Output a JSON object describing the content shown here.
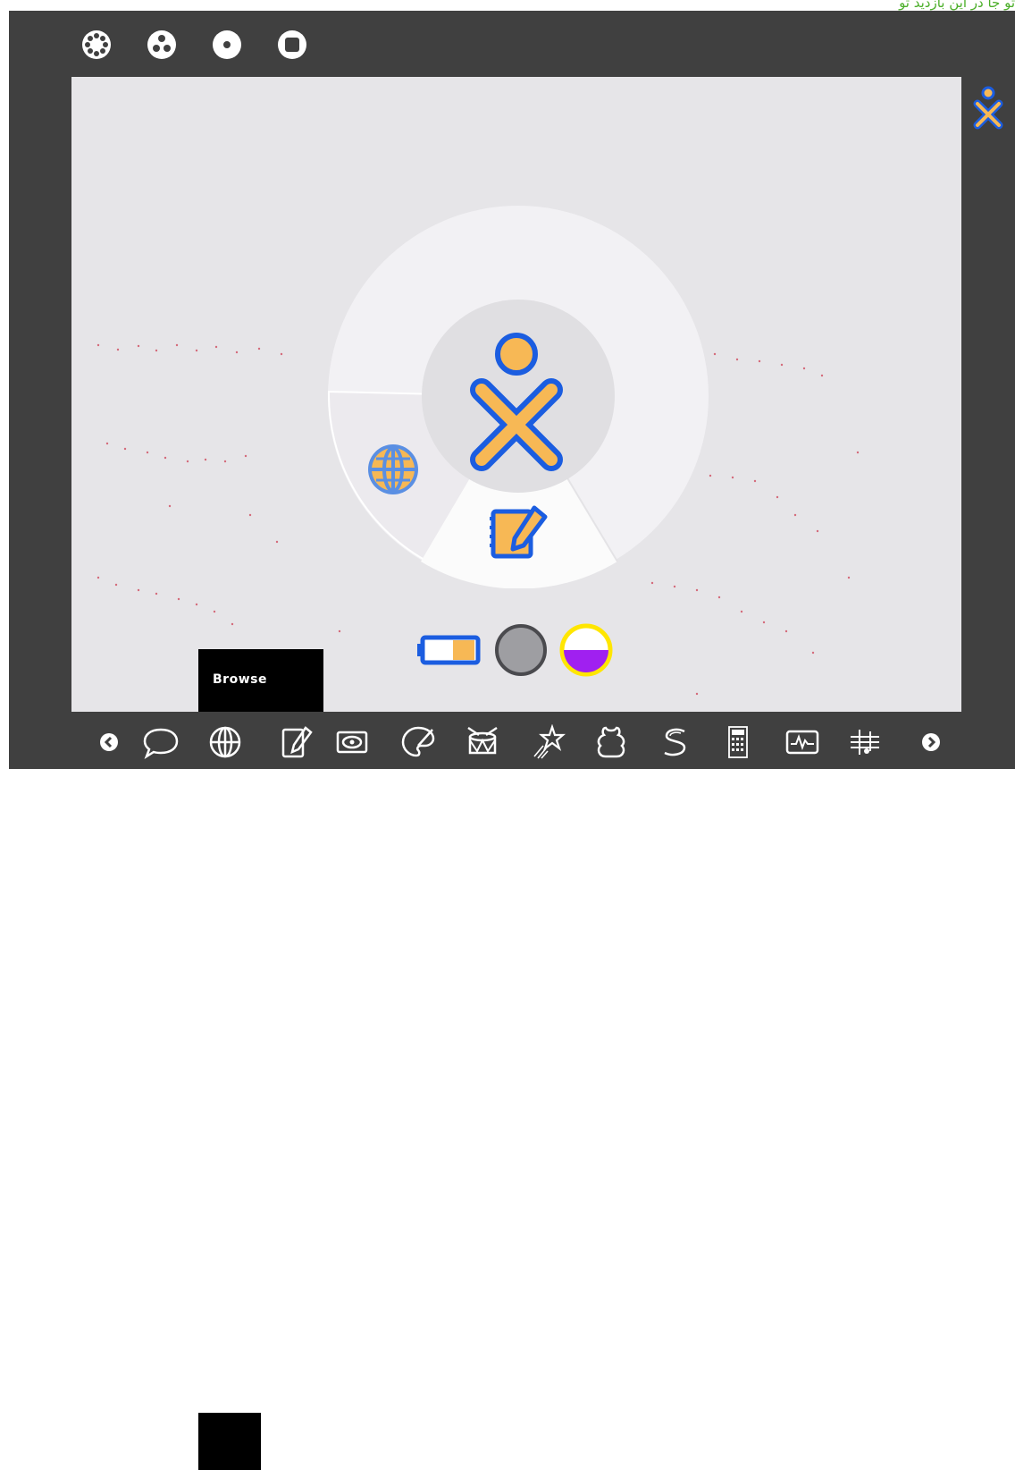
{
  "top_caption": "تو جا در این بازدید تو",
  "views": [
    {
      "name": "neighborhood-view",
      "icon": "neighborhood-icon"
    },
    {
      "name": "group-view",
      "icon": "group-icon"
    },
    {
      "name": "home-view",
      "icon": "home-icon"
    },
    {
      "name": "activity-view",
      "icon": "activity-icon"
    }
  ],
  "home": {
    "center_icon": "xo-buddy-icon",
    "ring_activities": [
      "browse-icon",
      "write-icon"
    ],
    "tray": [
      "battery-icon",
      "network-icon",
      "storage-icon"
    ]
  },
  "palette": {
    "label": "Browse"
  },
  "toolbar": {
    "items": [
      "scroll-left-icon",
      "chat-icon",
      "browse-icon",
      "write-icon",
      "record-icon",
      "paint-icon",
      "tamtam-icon",
      "star-icon",
      "etoys-icon",
      "turtle-icon",
      "calculate-icon",
      "measure-icon",
      "tamtam-edit-icon",
      "scroll-right-icon"
    ]
  },
  "colors": {
    "frame": "#404040",
    "desktop": "#e6e5e8",
    "xo_stroke": "#1b5de0",
    "xo_fill": "#f7b855",
    "globe": "#5a8fe3",
    "storage_fill": "#a020f0",
    "storage_ring": "#ffe600"
  }
}
